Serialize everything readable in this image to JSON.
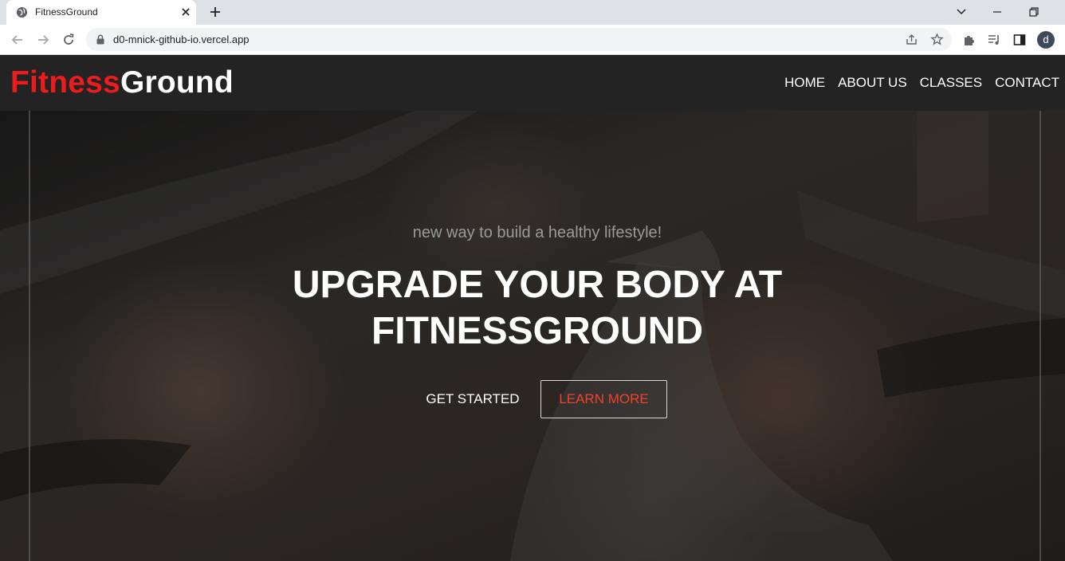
{
  "browser": {
    "tab_title": "FitnessGround",
    "url": "d0-mnick-github-io.vercel.app",
    "profile_initial": "d",
    "icons": [
      "globe-icon",
      "close-icon",
      "plus-icon",
      "chevron-down-icon",
      "minimize-icon",
      "restore-icon",
      "back-icon",
      "forward-icon",
      "reload-icon",
      "lock-icon",
      "share-icon",
      "star-icon",
      "puzzle-icon",
      "media-icon",
      "side-panel-icon"
    ]
  },
  "site": {
    "logo_part1": "Fitness",
    "logo_part2": "Ground",
    "nav": [
      "HOME",
      "ABOUT US",
      "CLASSES",
      "CONTACT"
    ],
    "hero": {
      "tagline": "new way to build a healthy lifestyle!",
      "headline_line1": "UPGRADE YOUR BODY AT",
      "headline_line2": "FITNESSGROUND",
      "cta_primary": "GET STARTED",
      "cta_secondary": "LEARN MORE"
    }
  },
  "colors": {
    "brand_red": "#ec1c1c",
    "cta_orange": "#f0412c",
    "header_bg": "#232323"
  }
}
